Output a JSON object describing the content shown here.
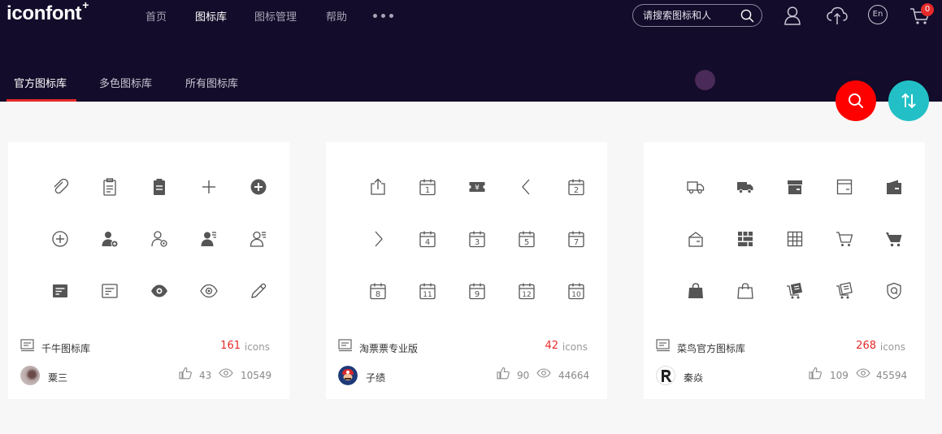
{
  "header": {
    "logo": "iconfont",
    "logo_mark": "+",
    "nav": [
      "首页",
      "图标库",
      "图标管理",
      "帮助"
    ],
    "search_placeholder": "请搜索图标和人",
    "lang_label": "En",
    "cart_count": "0"
  },
  "tabs": [
    "官方图标库",
    "多色图标库",
    "所有图标库"
  ],
  "colors": {
    "header_bg": "#130c2a",
    "accent_red": "#e52a2a",
    "fab_red": "#ff0000",
    "fab_teal": "#22c0c6"
  },
  "cards": [
    {
      "name": "千牛图标库",
      "count": "161",
      "unit": "icons",
      "author": "粟三",
      "likes": "43",
      "views": "10549",
      "icons": [
        "paperclip-icon",
        "clipboard-icon",
        "clipboard-filled-icon",
        "plus-icon",
        "plus-circle-filled-icon",
        "plus-circle-icon",
        "user-add-filled-icon",
        "user-settings-icon",
        "user-card-filled-icon",
        "user-card-icon",
        "message-filled-icon",
        "message-icon",
        "eye-filled-icon",
        "eye-icon",
        "pencil-icon"
      ]
    },
    {
      "name": "淘票票专业版",
      "count": "42",
      "unit": "icons",
      "author": "子绩",
      "likes": "90",
      "views": "44664",
      "icons": [
        "share-icon",
        "calendar-1-icon",
        "ticket-icon",
        "chevron-left-icon",
        "calendar-2-icon",
        "chevron-right-icon",
        "calendar-4-icon",
        "calendar-3-icon",
        "calendar-5-icon",
        "calendar-7-icon",
        "calendar-8-icon",
        "calendar-11-icon",
        "calendar-9-icon",
        "calendar-12-icon",
        "calendar-10-icon"
      ],
      "calendar_numbers": {
        "calendar-1-icon": "1",
        "calendar-2-icon": "2",
        "calendar-4-icon": "4",
        "calendar-3-icon": "3",
        "calendar-5-icon": "5",
        "calendar-7-icon": "7",
        "calendar-8-icon": "8",
        "calendar-11-icon": "11",
        "calendar-9-icon": "9",
        "calendar-12-icon": "12",
        "calendar-10-icon": "10"
      }
    },
    {
      "name": "菜鸟官方图标库",
      "count": "268",
      "unit": "icons",
      "author": "秦焱",
      "likes": "109",
      "views": "45594",
      "icons": [
        "truck-icon",
        "truck-filled-icon",
        "box-filled-icon",
        "box-icon",
        "wallet-filled-icon",
        "home-box-icon",
        "grid-filled-icon",
        "grid-icon",
        "cart-icon",
        "cart-filled-icon",
        "shopping-bag-filled-icon",
        "shopping-bag-icon",
        "cart-document-filled-icon",
        "cart-document-icon",
        "shield-q-icon"
      ]
    }
  ]
}
